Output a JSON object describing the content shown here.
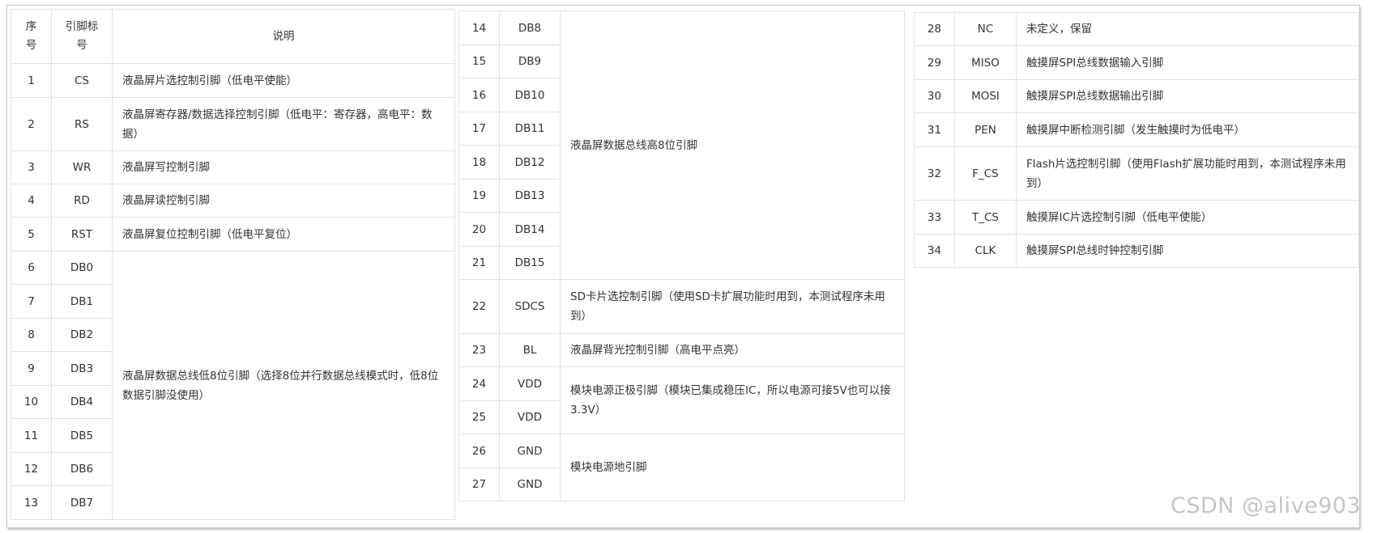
{
  "header": {
    "seq": "序号",
    "pin": "引脚标号",
    "desc": "说明"
  },
  "table1": [
    {
      "no": "1",
      "pin": "CS",
      "desc": "液晶屏片选控制引脚（低电平使能）"
    },
    {
      "no": "2",
      "pin": "RS",
      "desc": "液晶屏寄存器/数据选择控制引脚（低电平：寄存器，高电平：数据）"
    },
    {
      "no": "3",
      "pin": "WR",
      "desc": "液晶屏写控制引脚"
    },
    {
      "no": "4",
      "pin": "RD",
      "desc": "液晶屏读控制引脚"
    },
    {
      "no": "5",
      "pin": "RST",
      "desc": "液晶屏复位控制引脚（低电平复位）"
    },
    {
      "no": "6",
      "pin": "DB0"
    },
    {
      "no": "7",
      "pin": "DB1"
    },
    {
      "no": "8",
      "pin": "DB2"
    },
    {
      "no": "9",
      "pin": "DB3"
    },
    {
      "no": "10",
      "pin": "DB4"
    },
    {
      "no": "11",
      "pin": "DB5"
    },
    {
      "no": "12",
      "pin": "DB6"
    },
    {
      "no": "13",
      "pin": "DB7"
    }
  ],
  "table1_merged_desc": "液晶屏数据总线低8位引脚（选择8位并行数据总线模式时，低8位数据引脚没使用）",
  "table2": [
    {
      "no": "14",
      "pin": "DB8"
    },
    {
      "no": "15",
      "pin": "DB9"
    },
    {
      "no": "16",
      "pin": "DB10"
    },
    {
      "no": "17",
      "pin": "DB11"
    },
    {
      "no": "18",
      "pin": "DB12"
    },
    {
      "no": "19",
      "pin": "DB13"
    },
    {
      "no": "20",
      "pin": "DB14"
    },
    {
      "no": "21",
      "pin": "DB15"
    },
    {
      "no": "22",
      "pin": "SDCS",
      "desc": "SD卡片选控制引脚（使用SD卡扩展功能时用到，本测试程序未用到）"
    },
    {
      "no": "23",
      "pin": "BL",
      "desc": "液晶屏背光控制引脚（高电平点亮）"
    },
    {
      "no": "24",
      "pin": "VDD"
    },
    {
      "no": "25",
      "pin": "VDD"
    },
    {
      "no": "26",
      "pin": "GND"
    },
    {
      "no": "27",
      "pin": "GND"
    }
  ],
  "table2_merged": {
    "db_high": "液晶屏数据总线高8位引脚",
    "vdd": "模块电源正极引脚（模块已集成稳压IC，所以电源可接5V也可以接3.3V）",
    "gnd": "模块电源地引脚"
  },
  "table3": [
    {
      "no": "28",
      "pin": "NC",
      "desc": "未定义，保留"
    },
    {
      "no": "29",
      "pin": "MISO",
      "desc": "触摸屏SPI总线数据输入引脚"
    },
    {
      "no": "30",
      "pin": "MOSI",
      "desc": "触摸屏SPI总线数据输出引脚"
    },
    {
      "no": "31",
      "pin": "PEN",
      "desc": "触摸屏中断检测引脚（发生触摸时为低电平）"
    },
    {
      "no": "32",
      "pin": "F_CS",
      "desc": "Flash片选控制引脚（使用Flash扩展功能时用到，本测试程序未用到）"
    },
    {
      "no": "33",
      "pin": "T_CS",
      "desc": "触摸屏IC片选控制引脚（低电平使能）"
    },
    {
      "no": "34",
      "pin": "CLK",
      "desc": "触摸屏SPI总线时钟控制引脚"
    }
  ],
  "watermark": "CSDN @alive903"
}
